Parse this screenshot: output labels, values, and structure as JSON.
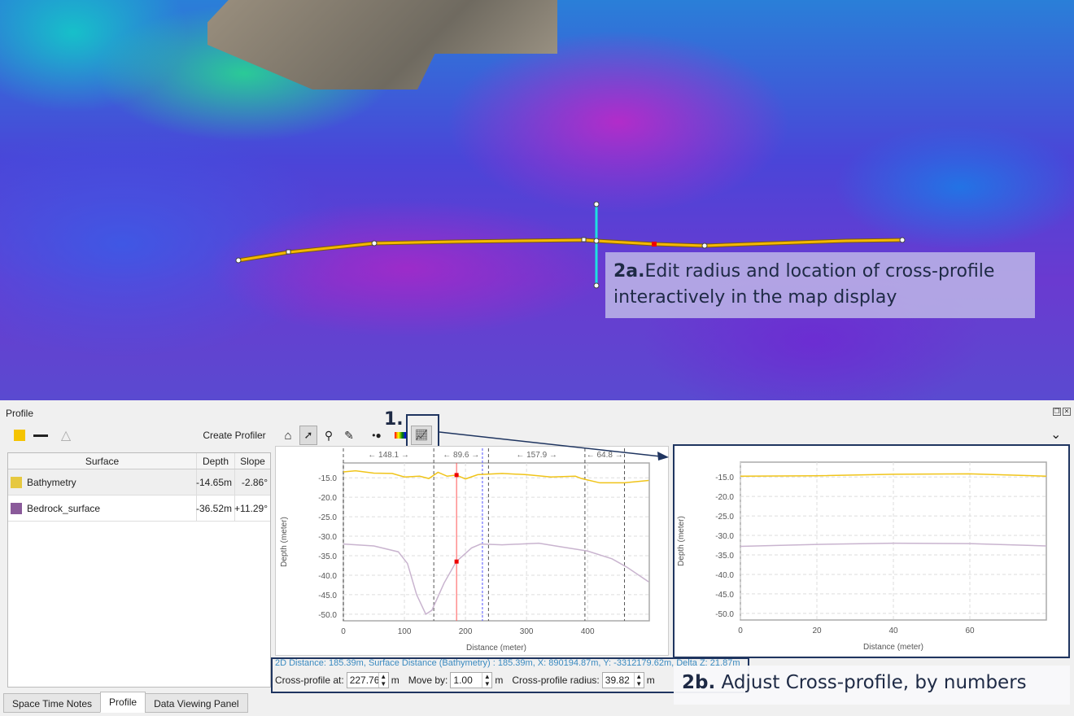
{
  "map": {
    "annotation_2a_num": "2a.",
    "annotation_2a_text": "Edit radius and location of cross-profile interactively in the map display"
  },
  "panel": {
    "title": "Profile",
    "create_profiler": "Create Profiler",
    "step_label": "1."
  },
  "table": {
    "headers": [
      "Surface",
      "Depth",
      "Slope"
    ],
    "rows": [
      {
        "surface": "Bathymetry",
        "depth": "-14.65m",
        "slope": "-2.86°",
        "color": "#e6c840"
      },
      {
        "surface": "Bedrock_surface",
        "depth": "-36.52m",
        "slope": "+11.29°",
        "color": "#8a5a9a"
      }
    ]
  },
  "status": "2D Distance: 185.39m, Surface Distance (Bathymetry) : 185.39m, X: 890194.87m, Y: -3312179.62m, Delta Z: 21.87m",
  "controls": {
    "cross_at_label": "Cross-profile at:",
    "cross_at_value": "227.76",
    "move_by_label": "Move by:",
    "move_by_value": "1.00",
    "radius_label": "Cross-profile radius:",
    "radius_value": "39.82",
    "unit": "m"
  },
  "annotation_2b_num": "2b.",
  "annotation_2b_text": "Adjust Cross-profile, by numbers",
  "tabs": [
    "Space Time Notes",
    "Profile",
    "Data Viewing Panel"
  ],
  "chart_data": [
    {
      "type": "line",
      "xlabel": "Distance (meter)",
      "ylabel": "Depth (meter)",
      "xlim": [
        0,
        501
      ],
      "ylim": [
        -51.7,
        -11.2
      ],
      "xticks": [
        0,
        100,
        200,
        300,
        400
      ],
      "yticks": [
        -15,
        -20,
        -25,
        -30,
        -35,
        -40,
        -45,
        -50
      ],
      "segment_markers": [
        0,
        148.1,
        237.7,
        395.6,
        460.4
      ],
      "segment_labels": [
        "← 148.1 →",
        "← 89.6 →",
        "← 157.9 →",
        "← 64.8 →"
      ],
      "cursor_x": 185.39,
      "cross_profile_x": 227.76,
      "series": [
        {
          "name": "Bathymetry",
          "color": "#f0c419",
          "x": [
            0,
            20,
            50,
            80,
            100,
            125,
            140,
            155,
            170,
            185,
            200,
            220,
            260,
            300,
            340,
            380,
            390,
            420,
            460,
            500
          ],
          "y": [
            -13.5,
            -13.2,
            -13.8,
            -13.9,
            -14.8,
            -14.6,
            -15.2,
            -13.6,
            -14.6,
            -14.3,
            -15.3,
            -14.2,
            -13.9,
            -14.2,
            -14.8,
            -14.6,
            -15.2,
            -16.3,
            -16.3,
            -15.7
          ]
        },
        {
          "name": "Bedrock_surface",
          "color": "#c9b4cf",
          "x": [
            0,
            50,
            90,
            105,
            120,
            135,
            145,
            165,
            185,
            210,
            225,
            260,
            320,
            360,
            400,
            440,
            465,
            500
          ],
          "y": [
            -32,
            -32.5,
            -34,
            -37,
            -45,
            -50,
            -49,
            -42,
            -36.5,
            -33,
            -32,
            -32.2,
            -31.8,
            -32.8,
            -33.8,
            -35.8,
            -38,
            -41.7
          ]
        }
      ]
    },
    {
      "type": "line",
      "xlabel": "Distance (meter)",
      "ylabel": "Depth (meter)",
      "xlim": [
        0,
        80
      ],
      "ylim": [
        -51.7,
        -11.2
      ],
      "xticks": [
        0,
        20,
        40,
        60
      ],
      "yticks": [
        -15,
        -20,
        -25,
        -30,
        -35,
        -40,
        -45,
        -50
      ],
      "series": [
        {
          "name": "Bathymetry",
          "color": "#f0c419",
          "x": [
            0,
            20,
            40,
            60,
            80
          ],
          "y": [
            -14.8,
            -14.7,
            -14.3,
            -14.2,
            -14.8
          ]
        },
        {
          "name": "Bedrock_surface",
          "color": "#c9b4cf",
          "x": [
            0,
            20,
            40,
            60,
            80
          ],
          "y": [
            -32.8,
            -32.3,
            -32.0,
            -32.1,
            -32.7
          ]
        }
      ]
    }
  ]
}
